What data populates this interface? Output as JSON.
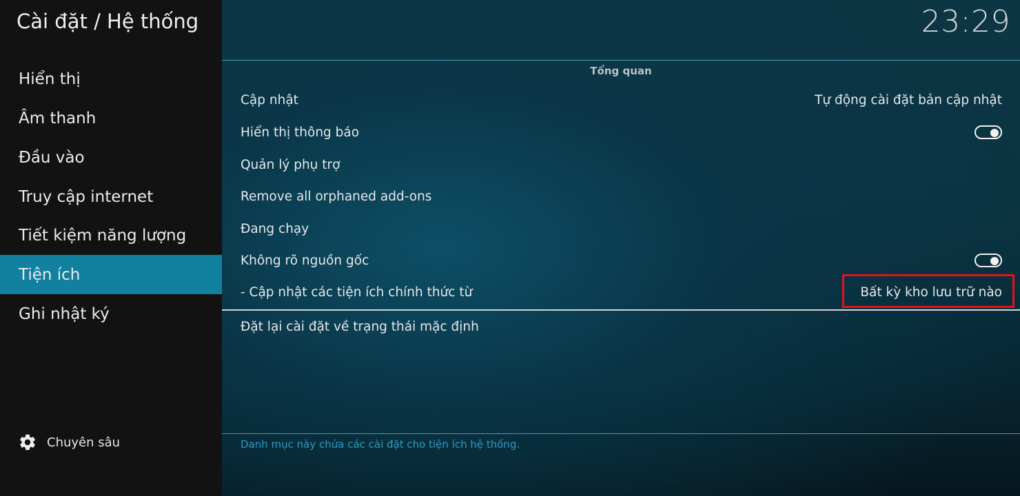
{
  "header": {
    "title": "Cài đặt / Hệ thống",
    "clock": "23:29"
  },
  "sidebar": {
    "items": [
      {
        "label": "Hiển thị"
      },
      {
        "label": "Âm thanh"
      },
      {
        "label": "Đầu vào"
      },
      {
        "label": "Truy cập internet"
      },
      {
        "label": "Tiết kiệm năng lượng"
      },
      {
        "label": "Tiện ích",
        "active": true
      },
      {
        "label": "Ghi nhật ký"
      }
    ],
    "advanced": {
      "label": "Chuyên sâu",
      "icon": "gear-icon"
    }
  },
  "main": {
    "section_title": "Tổng quan",
    "settings": [
      {
        "label": "Cập nhật",
        "value": "Tự động cài đặt bản cập nhật"
      },
      {
        "label": "Hiển thị thông báo",
        "toggle": true
      },
      {
        "label": "Quản lý phụ trợ"
      },
      {
        "label": "Remove all orphaned add-ons"
      },
      {
        "label": "Đang chạy"
      },
      {
        "label": "Không rõ nguồn gốc",
        "toggle": true
      },
      {
        "label": "- Cập nhật các tiện ích chính thức từ",
        "value": "Bất kỳ kho lưu trữ nào"
      }
    ],
    "reset_label": "Đặt lại cài đặt về trạng thái mặc định",
    "description": "Danh mục này chứa các cài đặt cho tiện ích hệ thống."
  },
  "colors": {
    "accent": "#12809f",
    "highlight_box": "#e0141c",
    "sidebar_bg": "#121212"
  }
}
